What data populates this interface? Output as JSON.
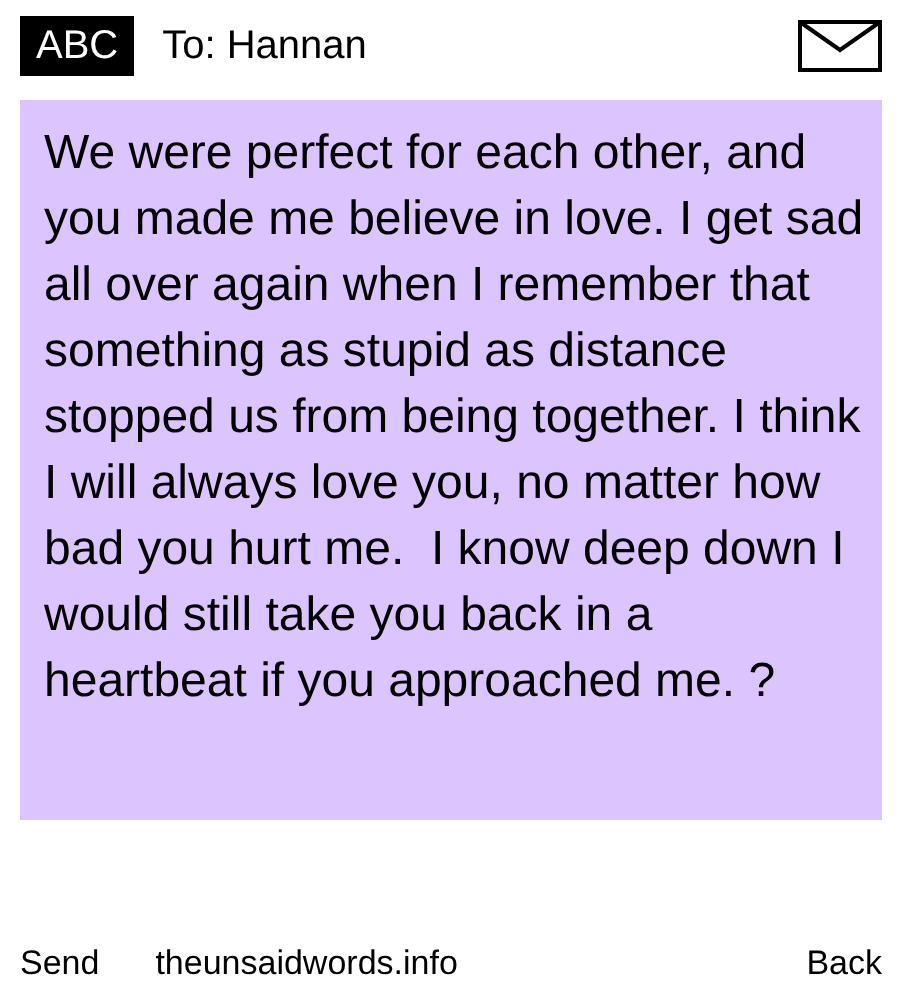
{
  "header": {
    "input_mode": "ABC",
    "recipient": "To: Hannan"
  },
  "message": {
    "text": "We were perfect for each other, and you made me believe in love. I get sad all over again when I remember that something as stupid as distance stopped us from being together. I think I will always love you, no matter how bad you hurt me.  I know deep down I would still take you back in a heartbeat if you approached me. ?"
  },
  "footer": {
    "left": "Send",
    "center": "theunsaidwords.info",
    "right": "Back"
  }
}
